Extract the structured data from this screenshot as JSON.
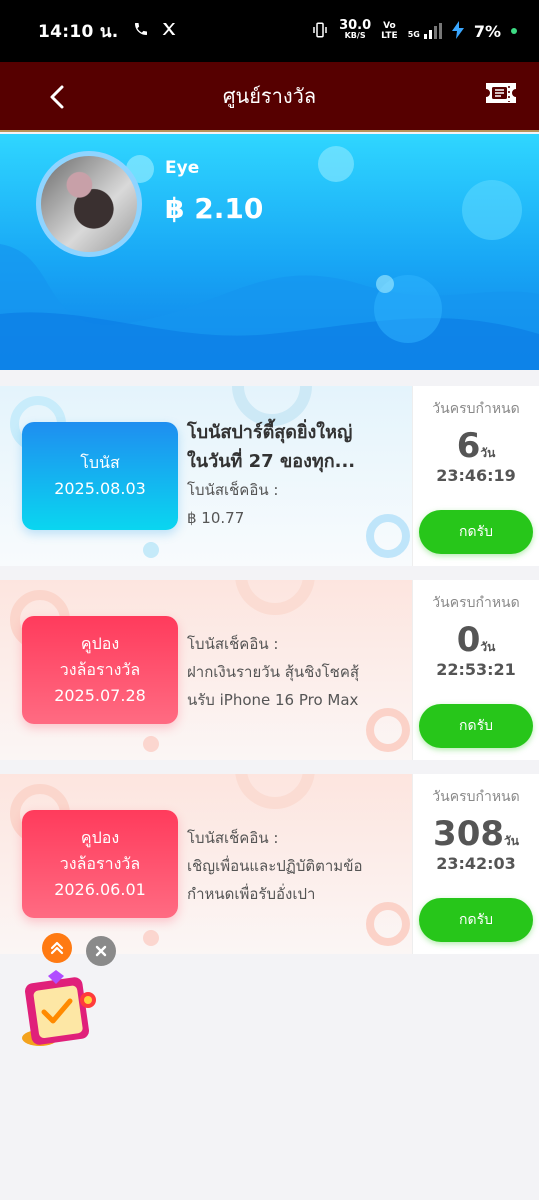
{
  "status_bar": {
    "time": "14:10 น.",
    "net_speed_value": "30.0",
    "net_speed_unit": "KB/S",
    "volte_top": "Vo",
    "volte_bottom": "LTE",
    "network": "5G",
    "battery": "7%"
  },
  "header": {
    "title": "ศูนย์รางวัล"
  },
  "profile": {
    "name": "Eye",
    "balance": "฿ 2.10"
  },
  "cards": [
    {
      "badge_lines": [
        "โบนัส",
        "2025.08.03"
      ],
      "title": "โบนัสปาร์ตี้สุดยิ่งใหญ่ในวันที่ 27 ของทุก...",
      "title_line1": "โบนัสปาร์ตี้สุดยิ่งใหญ่",
      "title_line2": "ในวันที่ 27 ของทุก...",
      "line1": "โบนัสเช็คอิน :",
      "line2": "฿ 10.77",
      "due_label": "วันครบกำหนด",
      "days": "6",
      "days_unit": "วัน",
      "time": "23:46:19",
      "claim": "กดรับ",
      "theme": "blue"
    },
    {
      "badge_lines": [
        "คูปอง",
        "วงล้อรางวัล",
        "2025.07.28"
      ],
      "line1": "โบนัสเช็คอิน :",
      "line2": "ฝากเงินรายวัน สุ้นชิงโชคสุ้",
      "line3": "นรับ iPhone 16 Pro Max",
      "due_label": "วันครบกำหนด",
      "days": "0",
      "days_unit": "วัน",
      "time": "22:53:21",
      "claim": "กดรับ",
      "theme": "pink"
    },
    {
      "badge_lines": [
        "คูปอง",
        "วงล้อรางวัล",
        "2026.06.01"
      ],
      "line1": "โบนัสเช็คอิน :",
      "line2": "เชิญเพื่อนและปฏิบัติตามข้อ",
      "line3": "กำหนดเพื่อรับอั่งเปา",
      "due_label": "วันครบกำหนด",
      "days": "308",
      "days_unit": "วัน",
      "time": "23:42:03",
      "claim": "กดรับ",
      "theme": "pink"
    }
  ],
  "colors": {
    "header_bg": "#560000",
    "claim_button": "#27c61a",
    "blue_badge": "#1f8ef0",
    "pink_badge": "#ff3b5c"
  }
}
